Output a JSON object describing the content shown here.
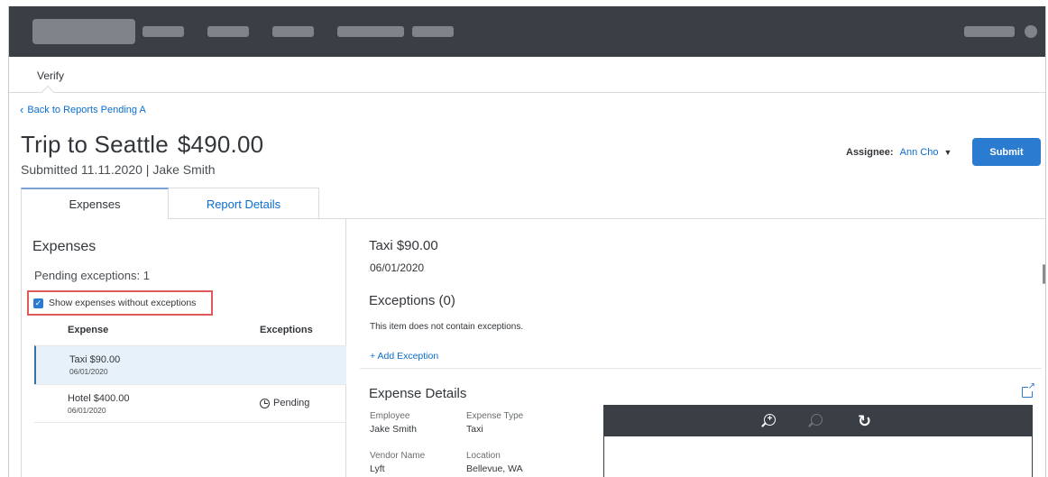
{
  "subnav": {
    "active": "Verify"
  },
  "back_link": "Back to Reports Pending A",
  "report": {
    "title": "Trip to Seattle",
    "amount": "$490.00",
    "submitted": "Submitted 11.11.2020 | Jake Smith"
  },
  "assignee": {
    "label": "Assignee:",
    "value": "Ann Cho"
  },
  "submit_label": "Submit",
  "tabs": [
    {
      "label": "Expenses",
      "active": true
    },
    {
      "label": "Report Details",
      "active": false
    }
  ],
  "expenses_panel": {
    "title": "Expenses",
    "pending_exceptions": "Pending exceptions: 1",
    "show_without_exceptions_label": "Show expenses without exceptions",
    "show_without_exceptions_checked": true,
    "columns": [
      "Expense",
      "Exceptions"
    ],
    "rows": [
      {
        "name": "Taxi $90.00",
        "date": "06/01/2020",
        "status": "",
        "selected": true
      },
      {
        "name": "Hotel $400.00",
        "date": "06/01/2020",
        "status": "Pending",
        "selected": false
      }
    ]
  },
  "detail": {
    "title": "Taxi $90.00",
    "date": "06/01/2020",
    "exceptions_heading": "Exceptions (0)",
    "no_exceptions_text": "This item does not contain exceptions.",
    "add_exception_label": "+ Add Exception",
    "details_heading": "Expense Details",
    "fields": {
      "employee_label": "Employee",
      "employee_value": "Jake Smith",
      "expense_type_label": "Expense Type",
      "expense_type_value": "Taxi",
      "vendor_label": "Vendor Name",
      "vendor_value": "Lyft",
      "location_label": "Location",
      "location_value": "Bellevue, WA"
    }
  },
  "viewer": {
    "icons": [
      "zoom-in-icon",
      "zoom-out-icon",
      "rotate-icon"
    ],
    "zoom_in_glyph": "+",
    "rotate_glyph": "↻"
  },
  "colors": {
    "topbar": "#3a3e45",
    "accent": "#0a6ed1",
    "button": "#2b7bd0",
    "highlight_box": "#e05a5a",
    "selected_row": "#e6f1fa"
  }
}
